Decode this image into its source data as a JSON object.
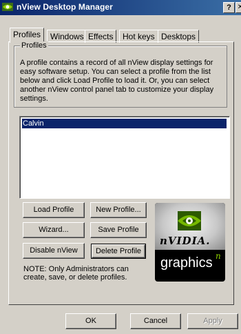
{
  "window": {
    "title": "nView Desktop Manager",
    "help_label": "?",
    "close_label": "✕"
  },
  "tabs": [
    {
      "label": "Profiles",
      "active": true
    },
    {
      "label": "Windows",
      "active": false
    },
    {
      "label": "Effects",
      "active": false
    },
    {
      "label": "Hot keys",
      "active": false
    },
    {
      "label": "Desktops",
      "active": false
    }
  ],
  "profiles_group": {
    "legend": "Profiles",
    "description": "A profile contains a record of all nView display settings for easy software setup. You can select a profile from the list below and click Load Profile to load it. Or, you can select another nView control panel tab to customize your display settings."
  },
  "profile_list": {
    "items": [
      "Calvin"
    ],
    "selected": "Calvin"
  },
  "buttons": {
    "load_profile": "Load Profile",
    "new_profile": "New Profile...",
    "wizard": "Wizard...",
    "save_profile": "Save Profile",
    "disable_nview": "Disable nView",
    "delete_profile": "Delete Profile"
  },
  "note": "NOTE: Only Administrators can create, save, or delete profiles.",
  "logo": {
    "brand": "nVIDIA.",
    "tagline": "graphics",
    "superscript": "n"
  },
  "dialog_buttons": {
    "ok": "OK",
    "cancel": "Cancel",
    "apply": "Apply"
  },
  "colors": {
    "titlebar": "#0a246a",
    "selection": "#0a246a",
    "face": "#d4d0c8",
    "logo_green": "#76b900"
  }
}
